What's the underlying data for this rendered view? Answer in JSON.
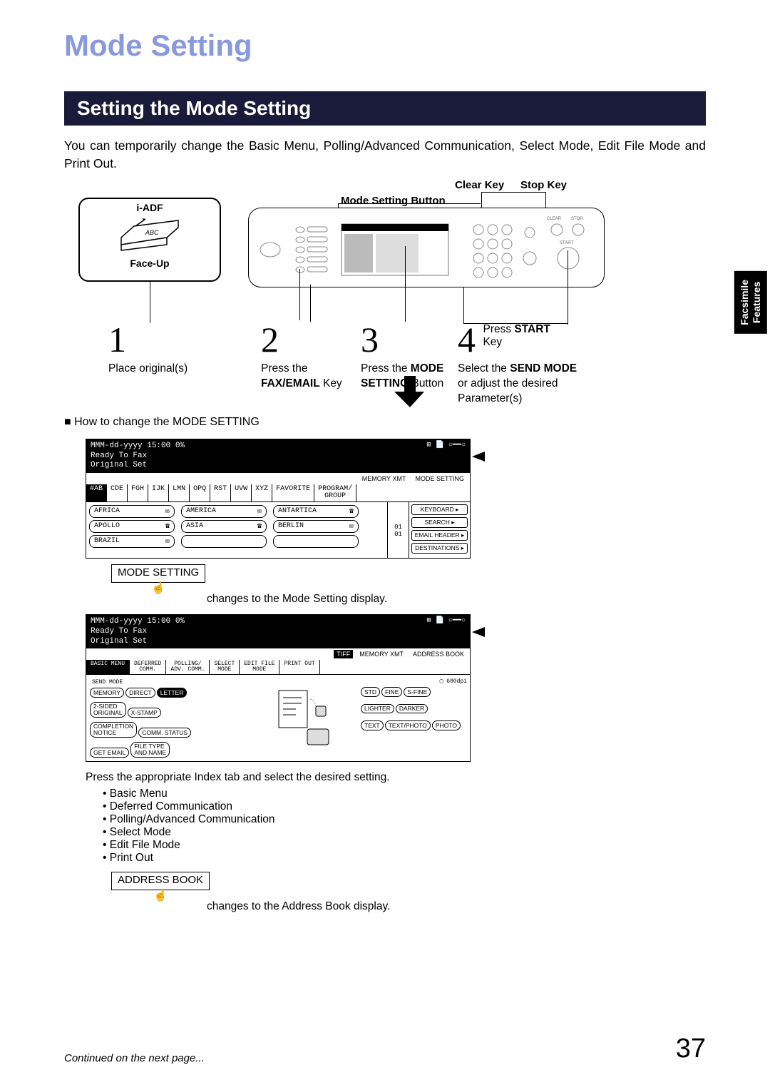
{
  "title": "Mode Setting",
  "section_header": "Setting the Mode Setting",
  "intro": "You can temporarily change the Basic Menu, Polling/Advanced Communication, Select Mode, Edit File Mode and Print Out.",
  "side_tab": "Facsimile\nFeatures",
  "labels": {
    "clear_key": "Clear Key",
    "stop_key": "Stop Key",
    "mode_setting_button": "Mode Setting Button",
    "iadf": "i-ADF",
    "faceup": "Face-Up"
  },
  "steps": {
    "s1": {
      "num": "1",
      "text": "Place original(s)"
    },
    "s2": {
      "num": "2",
      "text_pre": "Press the",
      "text_bold": "FAX/EMAIL",
      "text_post": " Key"
    },
    "s3": {
      "num": "3",
      "text_pre": "Press the ",
      "text_bold1": "MODE",
      "text_bold2": "SETTING",
      "text_post": " Button"
    },
    "s4": {
      "num": "4",
      "line1_pre": "Press ",
      "line1_bold": "START",
      "line1b": "Key",
      "line2_pre": "Select the ",
      "line2_bold": "SEND MODE",
      "line3": "or adjust the desired",
      "line4": "Parameter(s)"
    }
  },
  "howto": "■ How to change the MODE SETTING",
  "screen1": {
    "date": "MMM-dd-yyyy  15:00    0%",
    "ready": "Ready To Fax",
    "orig": "Original Set",
    "top_badges": [
      "MEMORY XMT",
      "MODE SETTING"
    ],
    "tabs": [
      "#AB",
      "CDE",
      "FGH",
      "IJK",
      "LMN",
      "OPQ",
      "RST",
      "UVW",
      "XYZ",
      "FAVORITE",
      "PROGRAM/\nGROUP"
    ],
    "list": [
      [
        "AFRICA",
        "✉"
      ],
      [
        "AMERICA",
        "✉"
      ],
      [
        "ANTARTICA",
        "☎"
      ],
      [
        "APOLLO",
        "☎"
      ],
      [
        "ASIA",
        "☎"
      ],
      [
        "BERLIN",
        "✉"
      ],
      [
        "BRAZIL",
        "✉"
      ]
    ],
    "right_buttons": [
      "KEYBOARD",
      "SEARCH",
      "EMAIL HEADER",
      "DESTINATIONS"
    ],
    "counter": "01\n01"
  },
  "touch1": "MODE SETTING",
  "caption1": "changes to the Mode Setting display.",
  "screen2": {
    "date": "MMM-dd-yyyy  15:00    0%",
    "ready": "Ready To Fax",
    "orig": "Original Set",
    "top_badges": [
      "TIFF",
      "MEMORY XMT",
      "ADDRESS BOOK"
    ],
    "tabs": [
      "BASIC MENU",
      "DEFERRED\nCOMM.",
      "POLLING/\nADV. COMM.",
      "SELECT\nMODE",
      "EDIT FILE\nMODE",
      "PRINT OUT"
    ],
    "send_mode": "SEND MODE",
    "left_pills": [
      "MEMORY",
      "DIRECT",
      "LETTER"
    ],
    "left_pills2": [
      "2-SIDED\nORIGINAL",
      "X-STAMP"
    ],
    "left_pills3": [
      "COMPLETION\nNOTICE",
      "COMM. STATUS"
    ],
    "left_pills4": [
      "GET EMAIL",
      "FILE TYPE\nAND NAME"
    ],
    "right_top": [
      "STD",
      "FINE",
      "S-FINE"
    ],
    "right_dpi": "600dpi",
    "right_mid": [
      "LIGHTER",
      "DARKER"
    ],
    "right_bot": [
      "TEXT",
      "TEXT/PHOTO",
      "PHOTO"
    ]
  },
  "instruction": "Press the appropriate Index tab and select the desired setting.",
  "bullets": [
    "Basic Menu",
    "Deferred Communication",
    "Polling/Advanced Communication",
    "Select Mode",
    "Edit File Mode",
    "Print Out"
  ],
  "touch2": "ADDRESS BOOK",
  "caption2": "changes to the Address Book display.",
  "continued": "Continued on the next page...",
  "page_number": "37"
}
